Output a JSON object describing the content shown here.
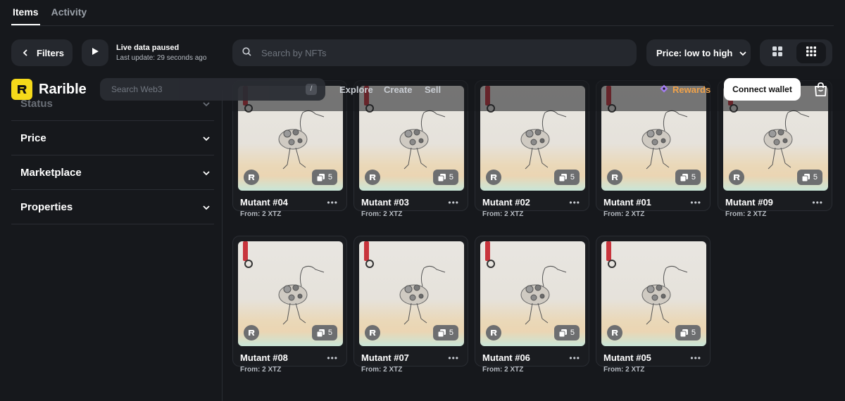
{
  "tabs": [
    {
      "label": "Items"
    },
    {
      "label": "Activity"
    }
  ],
  "toolbar": {
    "filters_label": "Filters",
    "live_title": "Live data paused",
    "live_subtitle": "Last update: 29 seconds ago",
    "search_placeholder": "Search by NFTs",
    "sort_label": "Price: low to high"
  },
  "header": {
    "brand": "Rarible",
    "search_placeholder": "Search Web3",
    "search_shortcut": "/",
    "nav": [
      "Explore",
      "Create",
      "Sell"
    ],
    "rewards_label": "Rewards",
    "connect_label": "Connect wallet"
  },
  "sidebar": {
    "facets": [
      {
        "label": "Status"
      },
      {
        "label": "Price"
      },
      {
        "label": "Marketplace"
      },
      {
        "label": "Properties"
      }
    ]
  },
  "items": [
    {
      "title": "Mutant #04",
      "price": "From: 2 XTZ",
      "count": "5"
    },
    {
      "title": "Mutant #03",
      "price": "From: 2 XTZ",
      "count": "5"
    },
    {
      "title": "Mutant #02",
      "price": "From: 2 XTZ",
      "count": "5"
    },
    {
      "title": "Mutant #01",
      "price": "From: 2 XTZ",
      "count": "5"
    },
    {
      "title": "Mutant #09",
      "price": "From: 2 XTZ",
      "count": "5"
    },
    {
      "title": "Mutant #08",
      "price": "From: 2 XTZ",
      "count": "5"
    },
    {
      "title": "Mutant #07",
      "price": "From: 2 XTZ",
      "count": "5"
    },
    {
      "title": "Mutant #06",
      "price": "From: 2 XTZ",
      "count": "5"
    },
    {
      "title": "Mutant #05",
      "price": "From: 2 XTZ",
      "count": "5"
    }
  ],
  "colors": {
    "accent": "#f5d91a",
    "rewards": "#f0a24a",
    "background": "#16181c",
    "panel": "#25282e"
  }
}
